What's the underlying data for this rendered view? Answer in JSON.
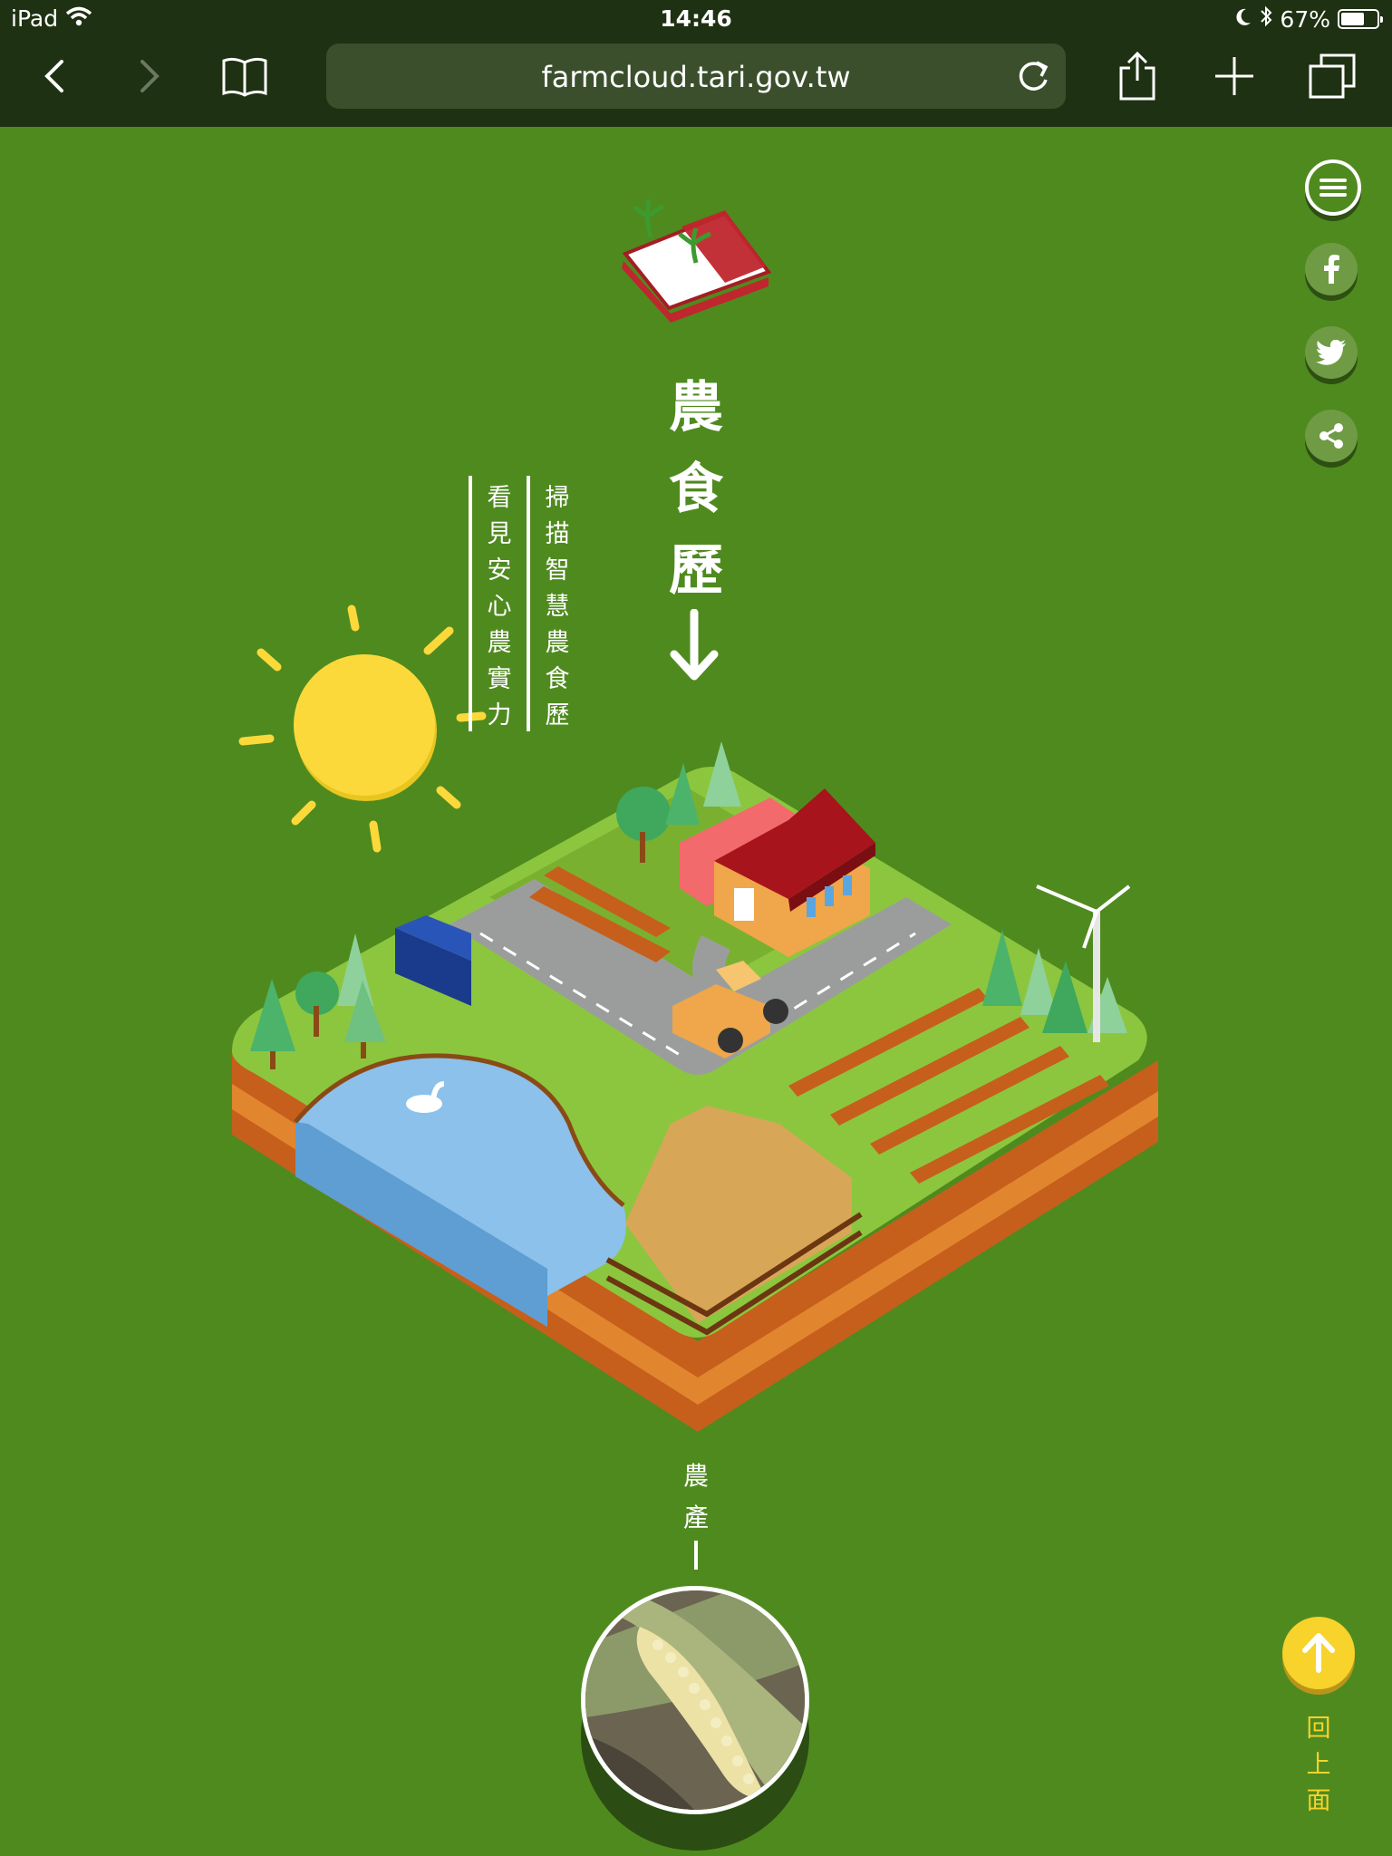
{
  "statusbar": {
    "device": "iPad",
    "time": "14:46",
    "battery": "67%",
    "battery_level": 0.67
  },
  "browser": {
    "url": "farmcloud.tari.gov.tw"
  },
  "page": {
    "title_chars": [
      "農",
      "食",
      "歷"
    ],
    "tagline_scan": [
      "掃",
      "描",
      "智",
      "慧",
      "農",
      "食",
      "歷"
    ],
    "tagline_see": [
      "看",
      "見",
      "安",
      "心",
      "農",
      "實",
      "力"
    ],
    "section_label": [
      "農",
      "產"
    ],
    "back_to_top": [
      "回",
      "上",
      "面"
    ],
    "calendar_label": "農食歷"
  },
  "icons": {
    "menu": "menu-icon",
    "facebook": "facebook-icon",
    "twitter": "twitter-icon",
    "share": "share-icon",
    "back_to_top": "arrow-up-icon",
    "down_arrow": "arrow-down-icon"
  },
  "colors": {
    "background": "#4f8a1f",
    "sun": "#fcd93a",
    "accent_yellow": "#f7d32b",
    "barn_red": "#b5121b",
    "soil": "#d9782a",
    "water": "#8bc1ea"
  }
}
